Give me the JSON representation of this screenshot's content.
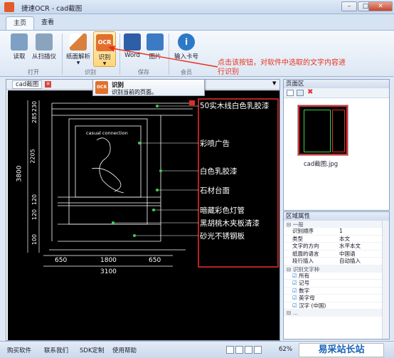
{
  "window": {
    "title": "捷速OCR - cad截图",
    "controls": [
      "–",
      "□",
      "✕"
    ]
  },
  "tabs": [
    "主页",
    "查看"
  ],
  "ribbon": {
    "buttons": [
      {
        "label": "读取",
        "icon": "read-icon",
        "color": "#7ea0c4"
      },
      {
        "label": "从扫描仪",
        "icon": "scanner-icon",
        "color": "#8aa4bd"
      },
      {
        "label": "纸面解析",
        "icon": "layout-analysis-icon",
        "color": "#d9803a"
      },
      {
        "label": "识别",
        "icon": "ocr-icon",
        "color": "#e2702c"
      },
      {
        "label": "Word",
        "icon": "word-icon",
        "color": "#2f5ea8"
      },
      {
        "label": "图片",
        "icon": "image-icon",
        "color": "#3c7bc4"
      },
      {
        "label": "输入卡号",
        "icon": "info-icon",
        "color": "#2d79c6"
      }
    ],
    "groups": [
      "打开",
      "识别",
      "保存",
      "会员"
    ]
  },
  "callout_text": "点击该按钮，对软件中选取的文字内容进行识别",
  "tooltip": {
    "title": "识别",
    "desc": "识别当前的页面。"
  },
  "document": {
    "tab": "cad截图"
  },
  "drawing": {
    "annotations": [
      "50实木线白色乳胶漆",
      "彩喷广告",
      "白色乳胶漆",
      "石材台面",
      "暗藏彩色灯管",
      "黑胡桃木夹板清漆",
      "砂光不锈钢板"
    ],
    "dims_left": [
      "230",
      "285",
      "2205",
      "120",
      "120",
      "100",
      "3800"
    ],
    "dims_bottom": [
      "650",
      "1800",
      "650",
      "3100"
    ],
    "sign_text": "casual connection"
  },
  "page_panel": {
    "title": "页面区",
    "thumb_label": "cad截图.jpg"
  },
  "props": {
    "title": "区域属性",
    "section1": "一般",
    "rows": [
      [
        "识别顺序",
        "1"
      ],
      [
        "类型",
        "本文"
      ],
      [
        "文字的方向",
        "水平本文"
      ],
      [
        "纸面的语言",
        "中国语"
      ],
      [
        "段行插入",
        "自动插入"
      ]
    ],
    "section2": "识别文字种",
    "checks": [
      "所有",
      "记号",
      "数字",
      "英字母",
      "汉字 (中国)"
    ],
    "section3": "..."
  },
  "status": {
    "links": [
      "购买软件",
      "联系我们",
      "SDK定制",
      "使用帮助"
    ],
    "zoom": "62%"
  },
  "watermark": "易采站长站"
}
